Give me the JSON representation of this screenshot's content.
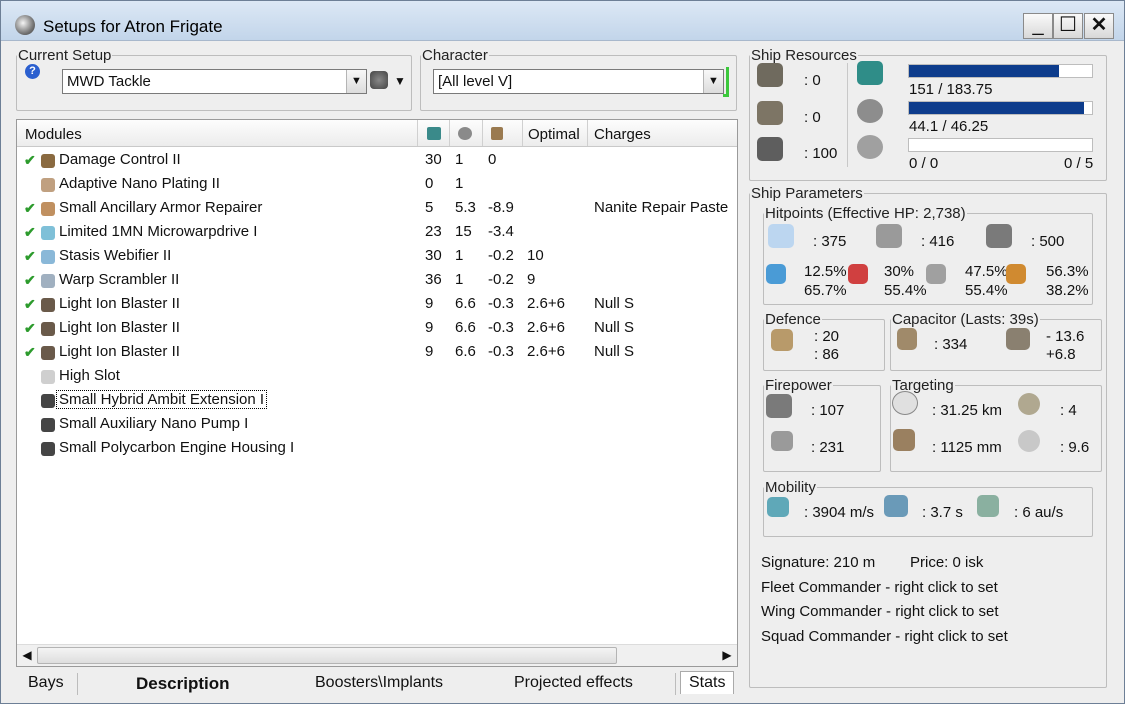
{
  "window": {
    "title": "Setups for Atron Frigate",
    "min": "_",
    "max": "☐",
    "close": "✕"
  },
  "current_setup": {
    "legend": "Current Setup",
    "value": "MWD Tackle"
  },
  "character": {
    "legend": "Character",
    "value": "[All level V]"
  },
  "modules": {
    "headers": {
      "name": "Modules",
      "optimal": "Optimal",
      "charges": "Charges"
    },
    "rows": [
      {
        "checked": "✔",
        "name": "Damage Control II",
        "c1": "30",
        "c2": "1",
        "c3": "0",
        "c4": "",
        "c5": "",
        "icon": "damage-control-icon"
      },
      {
        "checked": "",
        "name": "Adaptive Nano Plating II",
        "c1": "0",
        "c2": "1",
        "c3": "",
        "c4": "",
        "c5": "",
        "icon": "armor-plating-icon"
      },
      {
        "checked": "✔",
        "name": "Small Ancillary Armor Repairer",
        "c1": "5",
        "c2": "5.3",
        "c3": "-8.9",
        "c4": "",
        "c5": "Nanite Repair Paste",
        "icon": "armor-repairer-icon"
      },
      {
        "checked": "✔",
        "name": "Limited 1MN Microwarpdrive I",
        "c1": "23",
        "c2": "15",
        "c3": "-3.4",
        "c4": "",
        "c5": "",
        "icon": "microwarpdrive-icon"
      },
      {
        "checked": "✔",
        "name": "Stasis Webifier II",
        "c1": "30",
        "c2": "1",
        "c3": "-0.2",
        "c4": "10",
        "c5": "",
        "icon": "webifier-icon"
      },
      {
        "checked": "✔",
        "name": "Warp Scrambler II",
        "c1": "36",
        "c2": "1",
        "c3": "-0.2",
        "c4": "9",
        "c5": "",
        "icon": "warp-scrambler-icon"
      },
      {
        "checked": "✔",
        "name": "Light Ion Blaster II",
        "c1": "9",
        "c2": "6.6",
        "c3": "-0.3",
        "c4": "2.6+6",
        "c5": "Null S",
        "icon": "blaster-icon"
      },
      {
        "checked": "✔",
        "name": "Light Ion Blaster II",
        "c1": "9",
        "c2": "6.6",
        "c3": "-0.3",
        "c4": "2.6+6",
        "c5": "Null S",
        "icon": "blaster-icon"
      },
      {
        "checked": "✔",
        "name": "Light Ion Blaster II",
        "c1": "9",
        "c2": "6.6",
        "c3": "-0.3",
        "c4": "2.6+6",
        "c5": "Null S",
        "icon": "blaster-icon"
      },
      {
        "checked": "",
        "name": "High Slot",
        "c1": "",
        "c2": "",
        "c3": "",
        "c4": "",
        "c5": "",
        "icon": "empty-slot-icon"
      },
      {
        "checked": "",
        "name": "Small Hybrid Ambit Extension I",
        "c1": "",
        "c2": "",
        "c3": "",
        "c4": "",
        "c5": "",
        "icon": "rig-icon"
      },
      {
        "checked": "",
        "name": "Small Auxiliary Nano Pump I",
        "c1": "",
        "c2": "",
        "c3": "",
        "c4": "",
        "c5": "",
        "icon": "rig-icon"
      },
      {
        "checked": "",
        "name": "Small Polycarbon Engine Housing I",
        "c1": "",
        "c2": "",
        "c3": "",
        "c4": "",
        "c5": "",
        "icon": "rig-icon"
      }
    ]
  },
  "tabs": {
    "bays": "Bays",
    "description": "Description",
    "boosters": "Boosters\\Implants",
    "projected": "Projected effects",
    "stats": "Stats"
  },
  "resources": {
    "legend": "Ship Resources",
    "turrets": ": 0",
    "launchers": ": 0",
    "drones": ": 100",
    "cpu": "151 / 183.75",
    "cpu_fraction": 0.822,
    "power": "44.1 / 46.25",
    "power_fraction": 0.954,
    "drone_bw": "0 / 0",
    "drone_active": "0 / 5",
    "drone_fraction": 0
  },
  "parameters": {
    "legend": "Ship Parameters",
    "hitpoints": {
      "legend": "Hitpoints (Effective HP: 2,738)",
      "shield": ": 375",
      "armor": ": 416",
      "structure": ": 500",
      "em_shield": "12.5%",
      "em_armor": "65.7%",
      "therm_shield": "30%",
      "therm_armor": "55.4%",
      "kin_shield": "47.5%",
      "kin_armor": "55.4%",
      "exp_shield": "56.3%",
      "exp_armor": "38.2%"
    },
    "defence": {
      "legend": "Defence",
      "a": ": 20",
      "b": ": 86"
    },
    "capacitor": {
      "legend": "Capacitor (Lasts: 39s)",
      "amount": ": 334",
      "delta1": "- 13.6",
      "delta2": "+6.8"
    },
    "firepower": {
      "legend": "Firepower",
      "volley": ": 107",
      "dps": ": 231"
    },
    "targeting": {
      "legend": "Targeting",
      "range": ": 31.25 km",
      "targets": ": 4",
      "scan_res": ": 1125 mm",
      "sensor": ": 9.6"
    },
    "mobility": {
      "legend": "Mobility",
      "speed": ": 3904 m/s",
      "align": ": 3.7 s",
      "warp": ": 6 au/s"
    },
    "signature": "Signature: 210 m",
    "price": "Price: 0 isk",
    "fleet": "Fleet Commander - right click to set",
    "wing": "Wing Commander - right click to set",
    "squad": "Squad Commander - right click to set"
  },
  "colors": {
    "bar_fill": "#0d3c8c",
    "check": "#2d9b2d"
  }
}
